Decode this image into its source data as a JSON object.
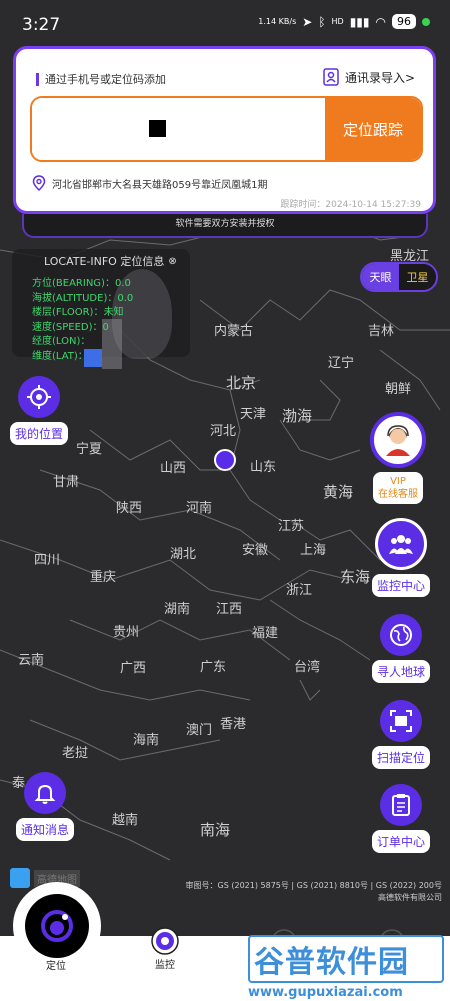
{
  "status_bar": {
    "time": "3:27",
    "net_speed": "1.14 KB/s",
    "signal": "HD",
    "battery": "96"
  },
  "card": {
    "hint": "通过手机号或定位码添加",
    "contacts_import": "通讯录导入>",
    "track_button": "定位跟踪",
    "address": "河北省邯郸市大名县天雄路059号靠近凤凰城1期",
    "track_time": "跟踪时间：2024-10-14 15:27:39",
    "notice": "软件需要双方安装并授权"
  },
  "info_panel": {
    "title": "LOCATE-INFO 定位信息",
    "rows": [
      "方位(BEARING)：0.0",
      "海拔(ALTITUDE)：0.0",
      "楼层(FLOOR)：未知",
      "速度(SPEED)：0",
      "经度(LON)：",
      "维度(LAT)："
    ]
  },
  "map_toggle": {
    "left": "天眼",
    "right": "卫星"
  },
  "map_labels": [
    "黑龙江",
    "内蒙古",
    "吉林",
    "辽宁",
    "北京",
    "天津",
    "朝鲜",
    "渤海",
    "河北",
    "宁夏",
    "山西",
    "山东",
    "甘肃",
    "黄海",
    "陕西",
    "河南",
    "江苏",
    "四川",
    "湖北",
    "安徽",
    "上海",
    "重庆",
    "东海",
    "浙江",
    "湖南",
    "江西",
    "贵州",
    "福建",
    "云南",
    "广西",
    "广东",
    "台湾",
    "澳门",
    "香港",
    "海南",
    "越南",
    "老挝",
    "南海",
    "泰"
  ],
  "fabs": {
    "my_location": "我的位置",
    "notification": "通知消息",
    "vip_line1": "VIP",
    "vip_line2": "在线客服",
    "monitor_center": "监控中心",
    "find_people": "寻人地球",
    "scan_locate": "扫描定位",
    "orders": "订单中心"
  },
  "attribution": {
    "line1": "审图号：GS (2021) 5875号 | GS (2021) 8810号 | GS (2022) 200号",
    "line2": "高德软件有限公司",
    "logo_text": "高德地图"
  },
  "nav": {
    "locate": "定位",
    "monitor": "监控",
    "third": "",
    "fourth": ""
  },
  "watermark": {
    "title": "谷普软件园",
    "url": "www.gupuxiazai.com"
  },
  "colors": {
    "accent": "#5b2ee6",
    "orange": "#f07a1e",
    "green": "#3ed66b"
  }
}
